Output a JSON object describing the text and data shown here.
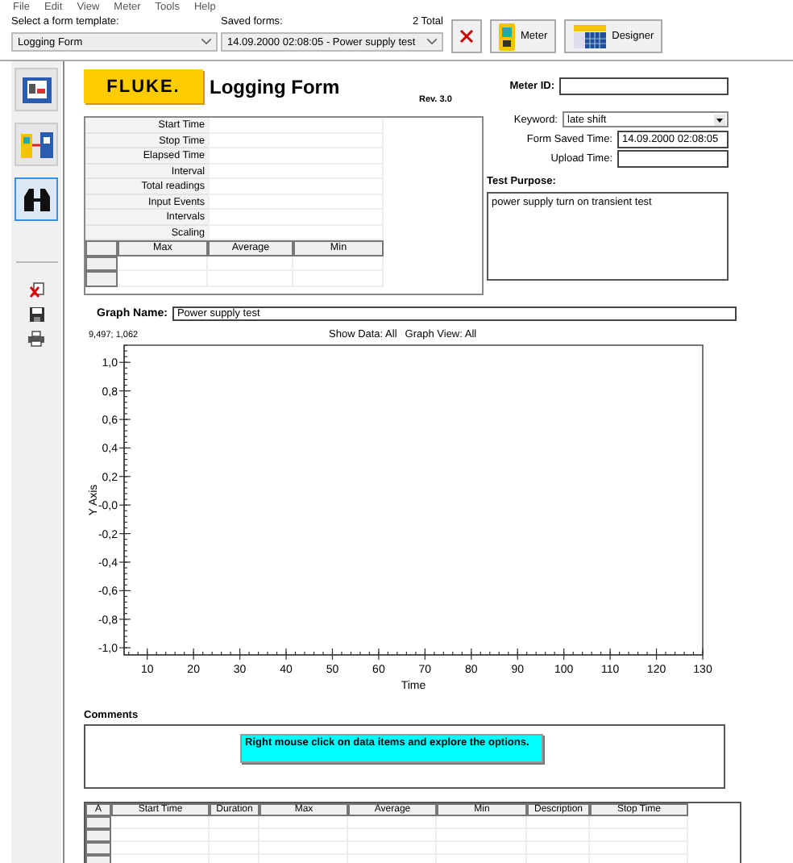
{
  "menu": [
    "File",
    "Edit",
    "View",
    "Meter",
    "Tools",
    "Help"
  ],
  "toolbar": {
    "template_label": "Select a form template:",
    "template": "Logging Form",
    "saved_label": "Saved forms:",
    "saved_count": "2 Total",
    "saved": "14.09.2000 02:08:05 - Power supply test",
    "buttons": [
      {
        "kind": "delete"
      },
      {
        "kind": "meter",
        "label": "Meter"
      },
      {
        "kind": "designer",
        "label": "Designer"
      }
    ]
  },
  "sidebar": {
    "tools": [
      {
        "kind": "form",
        "selected": false
      },
      {
        "kind": "transfer",
        "selected": false
      },
      {
        "kind": "view",
        "selected": true
      }
    ],
    "actions": [
      {
        "kind": "delete"
      },
      {
        "kind": "save"
      },
      {
        "kind": "print"
      }
    ]
  },
  "form": {
    "logo": "FLUKE.",
    "title": "Logging Form",
    "revision": "Rev. 3.0",
    "info_rows": [
      "Start Time",
      "Stop Time",
      "Elapsed Time",
      "Interval",
      "Total readings",
      "Input Events",
      "Intervals",
      "Scaling"
    ],
    "stats_columns": [
      "Max",
      "Average",
      "Min"
    ],
    "meter_id": {
      "label": "Meter ID:"
    },
    "keyword": {
      "label": "Keyword:",
      "value": "late shift"
    },
    "form_saved_time": {
      "label": "Form Saved Time:",
      "value": "14.09.2000 02:08:05"
    },
    "upload_time": {
      "label": "Upload Time:"
    },
    "test_purpose": {
      "label": "Test Purpose:",
      "value": "power supply turn on transient test"
    }
  },
  "graph": {
    "name_label": "Graph Name:",
    "name": "Power supply test",
    "cursor": "9,497; 1,062",
    "show_data": "Show Data: All",
    "graph_view": "Graph View: All",
    "chart_data": {
      "type": "line",
      "xlabel": "Time",
      "ylabel": "Y Axis",
      "xlim": [
        5,
        130
      ],
      "ylim": [
        -1.05,
        1.12
      ],
      "xticks": [
        10,
        20,
        30,
        40,
        50,
        60,
        70,
        80,
        90,
        100,
        110,
        120,
        130
      ],
      "yticks": [
        {
          "value": 1,
          "label": "1,0"
        },
        {
          "value": 0.8,
          "label": "0,8"
        },
        {
          "value": 0.6,
          "label": "0,6"
        },
        {
          "value": 0.4,
          "label": "0,4"
        },
        {
          "value": 0.2,
          "label": "0,2"
        },
        {
          "value": 0,
          "label": "-0,0"
        },
        {
          "value": -0.2,
          "label": "-0,2"
        },
        {
          "value": -0.4,
          "label": "-0,4"
        },
        {
          "value": -0.6,
          "label": "-0,6"
        },
        {
          "value": -0.8,
          "label": "-0,8"
        },
        {
          "value": -1,
          "label": "-1,0"
        }
      ]
    }
  },
  "comments": {
    "label": "Comments",
    "note": "Right mouse click on data items and explore the options."
  },
  "events_table": {
    "columns": [
      "A",
      "Start Time",
      "Duration",
      "Max",
      "Average",
      "Min",
      "Description",
      "Stop Time"
    ]
  }
}
